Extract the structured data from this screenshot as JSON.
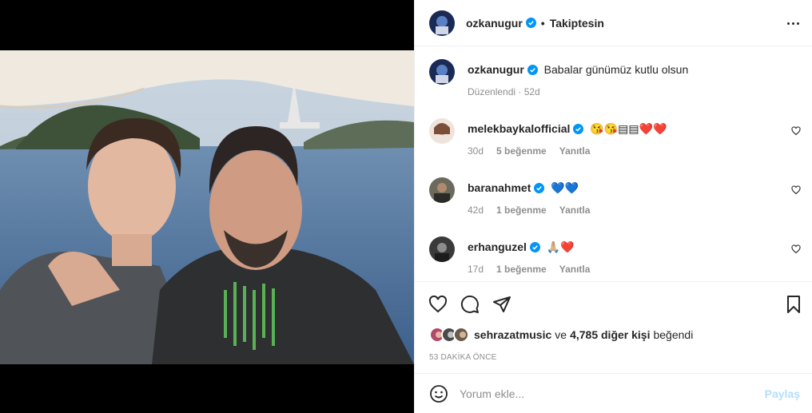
{
  "post": {
    "author": "ozkanugur",
    "follow_dot": "•",
    "follow_status": "Takiptesin",
    "caption": "Babalar günümüz kutlu olsun",
    "edited_label": "Düzenlendi · 52d"
  },
  "comments": [
    {
      "username": "melekbaykalofficial",
      "text": "😘😘▤▤❤️❤️",
      "age": "30d",
      "likes": "5 beğenme",
      "reply": "Yanıtla"
    },
    {
      "username": "baranahmet",
      "text": "💙💙",
      "age": "42d",
      "likes": "1 beğenme",
      "reply": "Yanıtla"
    },
    {
      "username": "erhanguzel",
      "text": "🙏🏼❤️",
      "age": "17d",
      "likes": "1 beğenme",
      "reply": "Yanıtla"
    }
  ],
  "likes_summary": {
    "first_user": "sehrazatmusic",
    "connector": "ve",
    "others": "4,785 diğer kişi",
    "suffix": "beğendi"
  },
  "timestamp": "53 DAKİKA ÖNCE",
  "add_comment": {
    "placeholder": "Yorum ekle...",
    "post_label": "Paylaş"
  },
  "colors": {
    "verified_blue": "#0095f6",
    "post_disabled": "#b2dffc",
    "meta_gray": "#8e8e8e"
  },
  "icons": [
    "verified-badge-icon",
    "more-options-icon",
    "heart-icon",
    "comment-icon",
    "share-icon",
    "bookmark-icon",
    "emoji-icon"
  ]
}
